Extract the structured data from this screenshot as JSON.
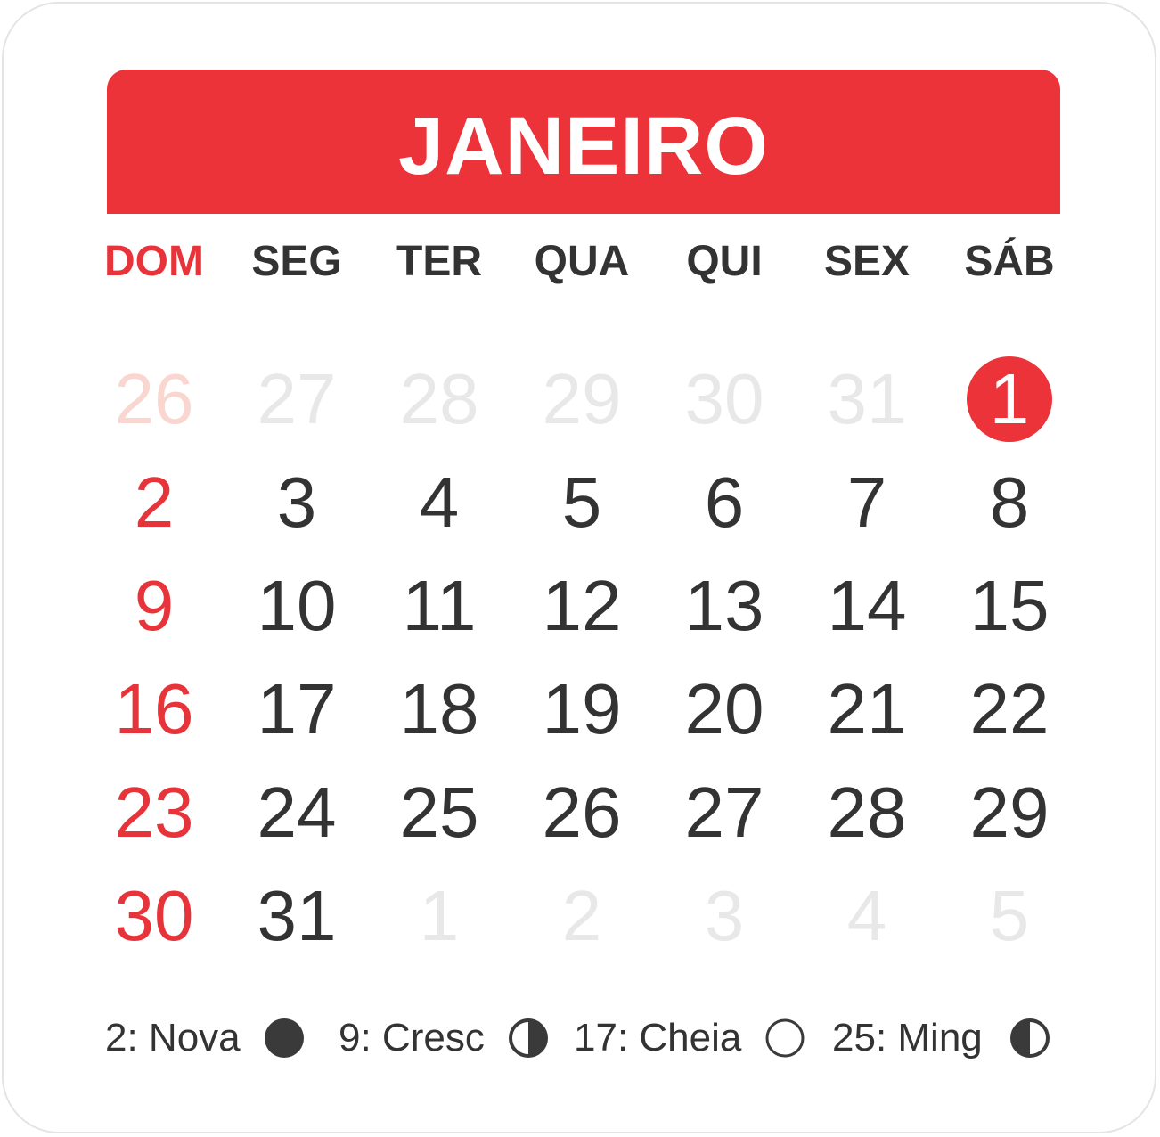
{
  "calendar": {
    "month": "JANEIRO",
    "weekdays": [
      "DOM",
      "SEG",
      "TER",
      "QUA",
      "QUI",
      "SEX",
      "SÁB"
    ],
    "days": [
      {
        "label": "26",
        "state": "other"
      },
      {
        "label": "27",
        "state": "other"
      },
      {
        "label": "28",
        "state": "other"
      },
      {
        "label": "29",
        "state": "other"
      },
      {
        "label": "30",
        "state": "other"
      },
      {
        "label": "31",
        "state": "other"
      },
      {
        "label": "1",
        "state": "today"
      },
      {
        "label": "2",
        "state": "current"
      },
      {
        "label": "3",
        "state": "current"
      },
      {
        "label": "4",
        "state": "current"
      },
      {
        "label": "5",
        "state": "current"
      },
      {
        "label": "6",
        "state": "current"
      },
      {
        "label": "7",
        "state": "current"
      },
      {
        "label": "8",
        "state": "current"
      },
      {
        "label": "9",
        "state": "current"
      },
      {
        "label": "10",
        "state": "current"
      },
      {
        "label": "11",
        "state": "current"
      },
      {
        "label": "12",
        "state": "current"
      },
      {
        "label": "13",
        "state": "current"
      },
      {
        "label": "14",
        "state": "current"
      },
      {
        "label": "15",
        "state": "current"
      },
      {
        "label": "16",
        "state": "current"
      },
      {
        "label": "17",
        "state": "current"
      },
      {
        "label": "18",
        "state": "current"
      },
      {
        "label": "19",
        "state": "current"
      },
      {
        "label": "20",
        "state": "current"
      },
      {
        "label": "21",
        "state": "current"
      },
      {
        "label": "22",
        "state": "current"
      },
      {
        "label": "23",
        "state": "current"
      },
      {
        "label": "24",
        "state": "current"
      },
      {
        "label": "25",
        "state": "current"
      },
      {
        "label": "26",
        "state": "current"
      },
      {
        "label": "27",
        "state": "current"
      },
      {
        "label": "28",
        "state": "current"
      },
      {
        "label": "29",
        "state": "current"
      },
      {
        "label": "30",
        "state": "current"
      },
      {
        "label": "31",
        "state": "current"
      },
      {
        "label": "1",
        "state": "other"
      },
      {
        "label": "2",
        "state": "other"
      },
      {
        "label": "3",
        "state": "other"
      },
      {
        "label": "4",
        "state": "other"
      },
      {
        "label": "5",
        "state": "other"
      }
    ],
    "moon_phases": [
      {
        "label": "2: Nova",
        "icon": "new-moon-icon"
      },
      {
        "label": "9: Cresc",
        "icon": "first-quarter-moon-icon"
      },
      {
        "label": "17: Cheia",
        "icon": "full-moon-icon"
      },
      {
        "label": "25: Ming",
        "icon": "last-quarter-moon-icon"
      }
    ]
  },
  "colors": {
    "accent": "#ec3339",
    "text": "#333333",
    "muted": "#e8e8e8",
    "muted_sunday": "#f9d6cf"
  }
}
